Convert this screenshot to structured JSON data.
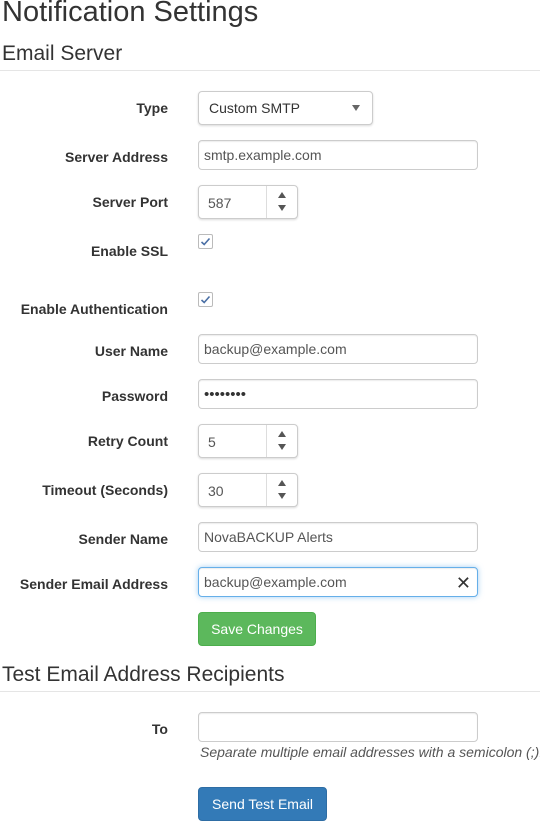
{
  "page": {
    "title": "Notification Settings"
  },
  "email_server": {
    "title": "Email Server",
    "type": {
      "label": "Type",
      "value": "Custom SMTP"
    },
    "server_address": {
      "label": "Server Address",
      "value": "smtp.example.com"
    },
    "server_port": {
      "label": "Server Port",
      "value": "587"
    },
    "enable_ssl": {
      "label": "Enable SSL",
      "checked": true
    },
    "enable_auth": {
      "label": "Enable Authentication",
      "checked": true
    },
    "user_name": {
      "label": "User Name",
      "value": "backup@example.com"
    },
    "password": {
      "label": "Password",
      "value": "••••••••"
    },
    "retry_count": {
      "label": "Retry Count",
      "value": "5"
    },
    "timeout": {
      "label": "Timeout (Seconds)",
      "value": "30"
    },
    "sender_name": {
      "label": "Sender Name",
      "value": "NovaBACKUP Alerts"
    },
    "sender_email": {
      "label": "Sender Email Address",
      "value": "backup@example.com",
      "clear_icon": "✕"
    },
    "save_label": "Save Changes"
  },
  "test_email": {
    "title": "Test Email Address Recipients",
    "to": {
      "label": "To",
      "value": "",
      "help": "Separate multiple email addresses with a semicolon (;)."
    },
    "send_label": "Send Test Email"
  },
  "colors": {
    "save": "#5cb85c",
    "send": "#337ab7",
    "focus": "#66afe9"
  }
}
